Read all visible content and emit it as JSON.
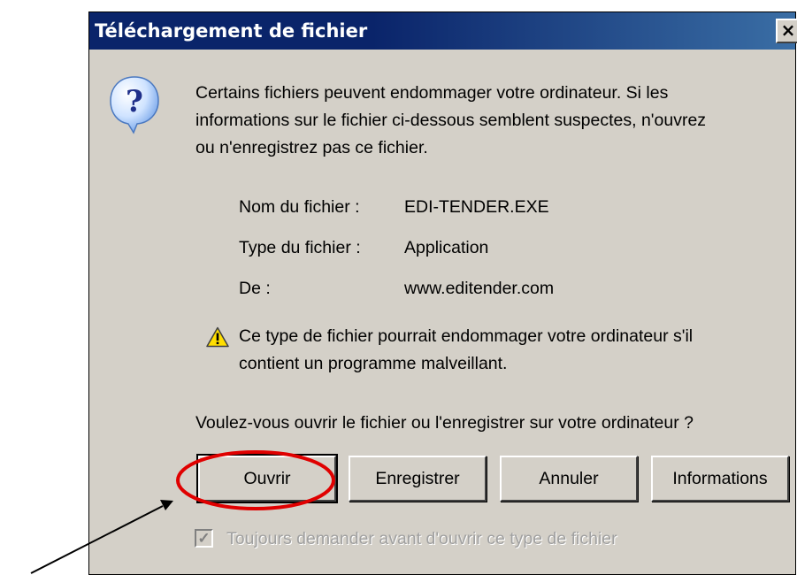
{
  "dialog": {
    "title": "Téléchargement de fichier",
    "close_label": "×",
    "message_lines": [
      "Certains fichiers peuvent endommager votre ordinateur. Si les",
      "informations sur le fichier ci-dessous semblent suspectes, n'ouvrez",
      "ou n'enregistrez pas ce fichier."
    ],
    "file_info": {
      "name_label": "Nom du fichier :",
      "name_value": "EDI-TENDER.EXE",
      "type_label": "Type du fichier :",
      "type_value": "Application",
      "from_label": "De :",
      "from_value": "www.editender.com"
    },
    "warning_lines": [
      "Ce type de fichier pourrait endommager votre ordinateur s'il",
      "contient un programme malveillant."
    ],
    "question": "Voulez-vous ouvrir le fichier ou l'enregistrer sur votre ordinateur ?",
    "buttons": {
      "open": "Ouvrir",
      "save": "Enregistrer",
      "cancel": "Annuler",
      "info": "Informations"
    },
    "always_ask": {
      "label": "Toujours demander avant d'ouvrir ce type de fichier",
      "checked": true,
      "enabled": false
    }
  },
  "icons": {
    "question": "question-icon",
    "warning": "warning-icon",
    "checkmark": "✓"
  },
  "colors": {
    "titlebar": "#0a246a",
    "dialog_bg": "#d4d0c8",
    "highlight": "#e00000"
  }
}
